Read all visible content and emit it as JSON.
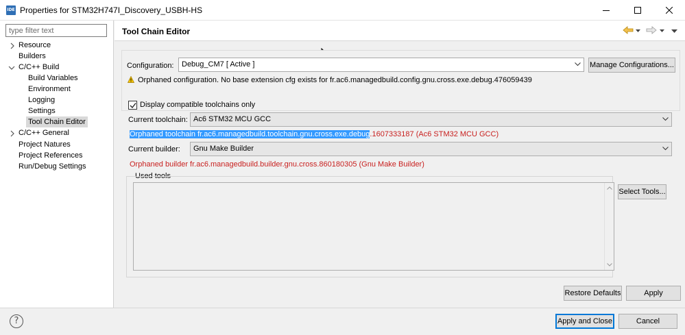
{
  "window": {
    "app_icon_text": "IDE",
    "title": "Properties for STM32H747I_Discovery_USBH-HS"
  },
  "sidebar": {
    "filter_placeholder": "type filter text",
    "items": [
      {
        "label": "Resource",
        "level": 0,
        "expandable": true,
        "expanded": false
      },
      {
        "label": "Builders",
        "level": 0,
        "expandable": false
      },
      {
        "label": "C/C++ Build",
        "level": 0,
        "expandable": true,
        "expanded": true
      },
      {
        "label": "Build Variables",
        "level": 1
      },
      {
        "label": "Environment",
        "level": 1
      },
      {
        "label": "Logging",
        "level": 1
      },
      {
        "label": "Settings",
        "level": 1
      },
      {
        "label": "Tool Chain Editor",
        "level": 1,
        "selected": true
      },
      {
        "label": "C/C++ General",
        "level": 0,
        "expandable": true,
        "expanded": false
      },
      {
        "label": "Project Natures",
        "level": 0
      },
      {
        "label": "Project References",
        "level": 0
      },
      {
        "label": "Run/Debug Settings",
        "level": 0
      }
    ]
  },
  "page": {
    "title": "Tool Chain Editor",
    "configuration_label": "Configuration:",
    "configuration_value": "Debug_CM7  [ Active ]",
    "manage_configurations": "Manage Configurations...",
    "orphaned_config_warning": "Orphaned configuration. No base extension cfg exists for fr.ac6.managedbuild.config.gnu.cross.exe.debug.476059439",
    "display_compatible_label": "Display compatible toolchains only",
    "display_compatible_checked": true,
    "current_toolchain_label": "Current toolchain:",
    "current_toolchain_value": "Ac6 STM32 MCU GCC",
    "orphaned_toolchain_selected": "Orphaned toolchain fr.ac6.managedbuild.toolchain.gnu.cross.exe.debug",
    "orphaned_toolchain_rest": ".1607333187 (Ac6 STM32 MCU GCC)",
    "current_builder_label": "Current builder:",
    "current_builder_value": "Gnu Make Builder",
    "orphaned_builder": "Orphaned builder fr.ac6.managedbuild.builder.gnu.cross.860180305 (Gnu Make Builder)",
    "used_tools_label": "Used tools",
    "select_tools": "Select Tools...",
    "restore_defaults": "Restore Defaults",
    "apply": "Apply"
  },
  "footer": {
    "help_glyph": "?",
    "apply_and_close": "Apply and Close",
    "cancel": "Cancel"
  },
  "colors": {
    "error_text": "#c8201f",
    "selection_highlight": "#3399ff",
    "default_button_border": "#0078d7"
  }
}
